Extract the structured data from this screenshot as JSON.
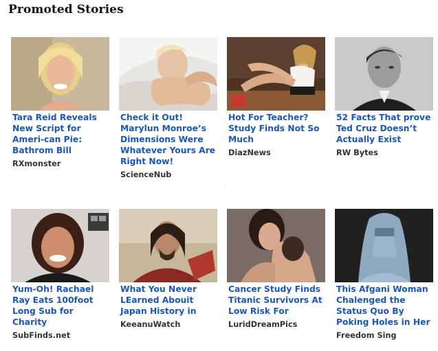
{
  "widget": {
    "heading": "Promoted Stories",
    "stories": [
      {
        "title": "Tara Reid Reveals New Script for Ameri-can Pie: Bathrom Bill",
        "source": "RXmonster",
        "image_icon": "portrait-blonde-woman-icon"
      },
      {
        "title": "Check it Out! Marylun Monroe’s Dimensions Were Whatever Yours Are Right Now!",
        "source": "ScienceNub",
        "image_icon": "reclining-woman-photo-icon"
      },
      {
        "title": "Hot For Teacher? Study Finds Not So Much",
        "source": "DiazNews",
        "image_icon": "woman-on-desk-photo-icon"
      },
      {
        "title": "52 Facts That prove Ted Cruz Doesn’t Actually Exist",
        "source": "RW Bytes",
        "image_icon": "yearbook-portrait-icon"
      },
      {
        "title": "Yum-Oh! Rachael Ray Eats 100foot Long Sub for Charity",
        "source": "SubFinds.net",
        "image_icon": "smiling-woman-portrait-icon"
      },
      {
        "title": "What You Never LEarned Abouit Japan History in",
        "source": "KeeanuWatch",
        "image_icon": "samurai-actor-photo-icon"
      },
      {
        "title": "Cancer  Study Finds Titanic Survivors At Low Risk For",
        "source": "LuridDreamPics",
        "image_icon": "couple-embrace-photo-icon"
      },
      {
        "title": "This Afgani Woman Chalenged the Status Quo By Poking Holes in Her",
        "source": "Freedom Sing",
        "image_icon": "burqa-woman-photo-icon"
      }
    ]
  },
  "colors": {
    "title_link": "#1a55c0",
    "source_text": "#333333",
    "heading_text": "#111111"
  }
}
